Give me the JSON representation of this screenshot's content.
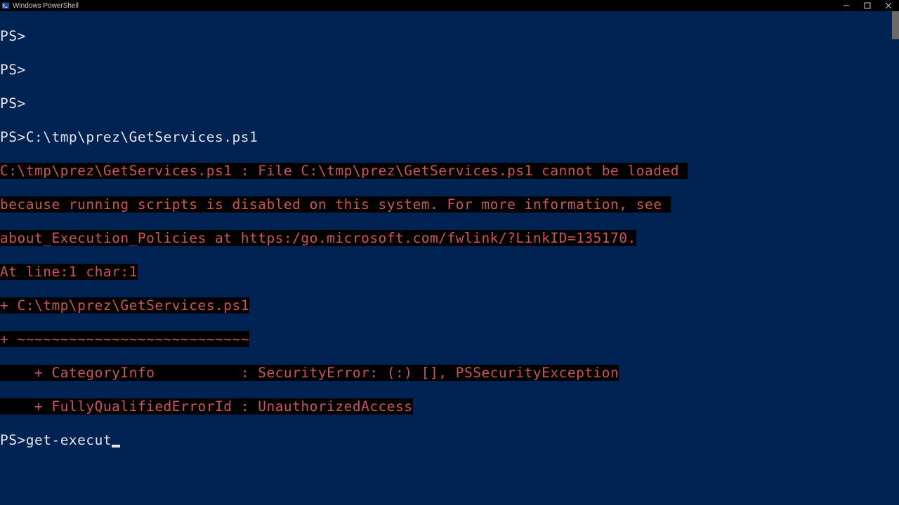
{
  "window": {
    "title": "Windows PowerShell"
  },
  "terminal": {
    "prompt": "PS>",
    "lines": {
      "empty1": "",
      "empty2": "",
      "empty3": "",
      "cmd1": "C:\\tmp\\prez\\GetServices.ps1",
      "err1": "C:\\tmp\\prez\\GetServices.ps1 : File C:\\tmp\\prez\\GetServices.ps1 cannot be loaded ",
      "err2": "because running scripts is disabled on this system. For more information, see ",
      "err3": "about_Execution_Policies at https:/go.microsoft.com/fwlink/?LinkID=135170.",
      "err4": "At line:1 char:1",
      "err5": "+ C:\\tmp\\prez\\GetServices.ps1",
      "err6": "+ ~~~~~~~~~~~~~~~~~~~~~~~~~~~",
      "err7": "    + CategoryInfo          : SecurityError: (:) [], PSSecurityException",
      "err8": "    + FullyQualifiedErrorId : UnauthorizedAccess",
      "current_input": "get-execut"
    }
  }
}
